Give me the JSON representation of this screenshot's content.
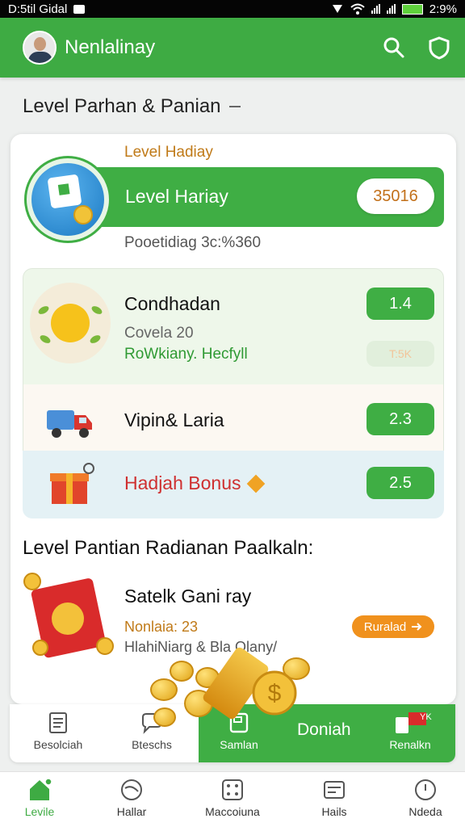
{
  "status_bar": {
    "left_text": "D:5til Gidal",
    "battery": "2:9%"
  },
  "app_bar": {
    "title": "Nenlalinay",
    "icons": [
      "search-icon",
      "shield-icon"
    ]
  },
  "section": {
    "title": "Level Parhan & Panian"
  },
  "level": {
    "small_label": "Level Hadiay",
    "bar_label": "Level Hariay",
    "value": "35016",
    "progress_text": "Pooetidiag 3c:%360"
  },
  "condition": {
    "title": "Condhadan",
    "subtitle": "Covela 20",
    "green_text": "RoWkiany. Hecfyll",
    "button": "1.4",
    "ghost": "T:5K"
  },
  "vip": {
    "title": "Vipin& Laria",
    "button": "2.3"
  },
  "bonus": {
    "title": "Hadjah Bonus",
    "button": "2.5"
  },
  "list": {
    "title": "Level Pantian Radianan Paalkaln:"
  },
  "pack": {
    "title": "Satelk Gani ray",
    "subtitle": "Nonlaia: 23",
    "subtitle2": "HlahiNiarg & Bla Olany/",
    "button": "Ruralad"
  },
  "actions": {
    "items": [
      {
        "label": "Besolciah",
        "icon": "document-icon"
      },
      {
        "label": "Bteschs",
        "icon": "chat-icon"
      },
      {
        "label": "Samlan",
        "icon": "wallet-icon"
      },
      {
        "label": "Doniah"
      },
      {
        "label": "Renalkn",
        "icon": "ticket-icon",
        "badge": "YK"
      }
    ]
  },
  "bottom_nav": {
    "items": [
      {
        "label": "Levile",
        "icon": "home-icon",
        "active": true
      },
      {
        "label": "Hallar",
        "icon": "globe-icon"
      },
      {
        "label": "Maccoiuna",
        "icon": "dice-icon"
      },
      {
        "label": "Hails",
        "icon": "card-icon"
      },
      {
        "label": "Ndeda",
        "icon": "clock-icon"
      }
    ]
  },
  "colors": {
    "primary": "#3eab43",
    "accent_orange": "#f0911d",
    "bonus_red": "#cf3030"
  }
}
